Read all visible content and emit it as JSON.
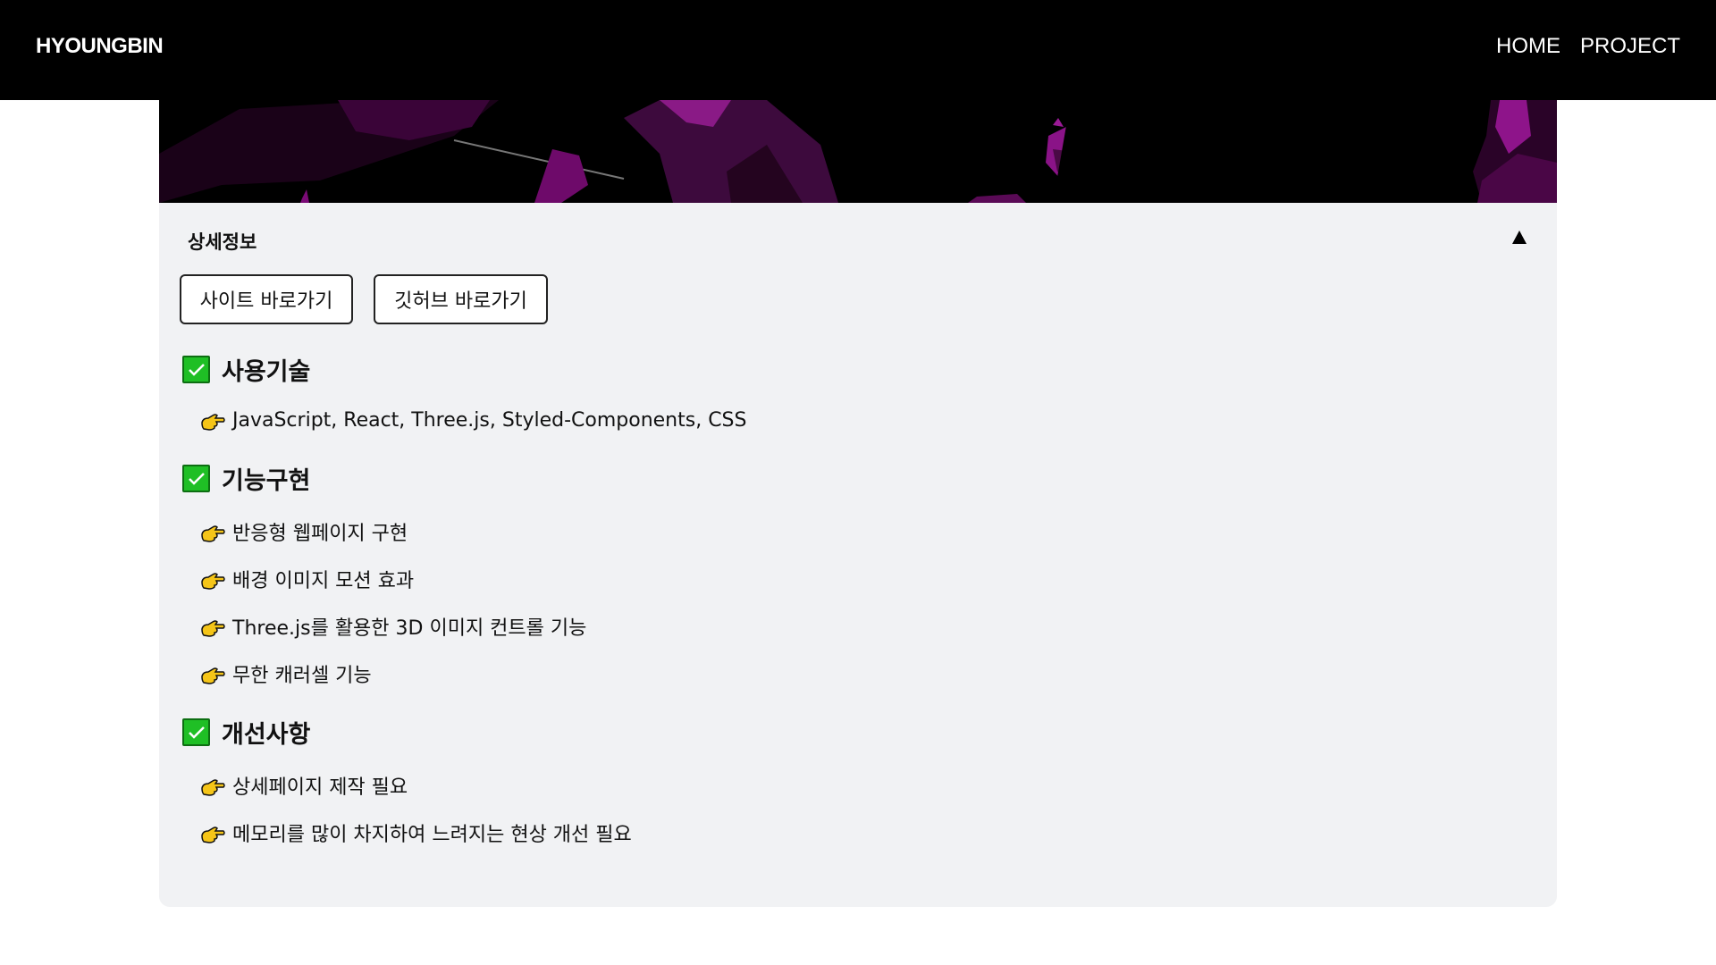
{
  "header": {
    "brand": "HYOUNGBIN",
    "nav": [
      {
        "label": "HOME"
      },
      {
        "label": "PROJECT"
      }
    ]
  },
  "panel": {
    "title": "상세정보",
    "toggle_icon": "triangle-up-icon",
    "buttons": {
      "site": "사이트 바로가기",
      "github": "깃허브 바로가기"
    },
    "sections": [
      {
        "title": "사용기술",
        "items": [
          "JavaScript, React, Three.js, Styled-Components, CSS"
        ]
      },
      {
        "title": "기능구현",
        "items": [
          "반응형 웹페이지 구현",
          "배경 이미지 모션 효과",
          "Three.js를 활용한 3D 이미지 컨트롤 기능",
          "무한 캐러셀 기능"
        ]
      },
      {
        "title": "개선사항",
        "items": [
          "상세페이지 제작 필요",
          "메모리를 많이 차지하여 느려지는 현상 개선 필요"
        ]
      }
    ]
  },
  "colors": {
    "header_bg": "#000000",
    "panel_bg": "#f1f2f4",
    "check_green": "#1fbf25",
    "hand_yellow": "#f5c518",
    "banner_purple": "#5c0a5c"
  }
}
